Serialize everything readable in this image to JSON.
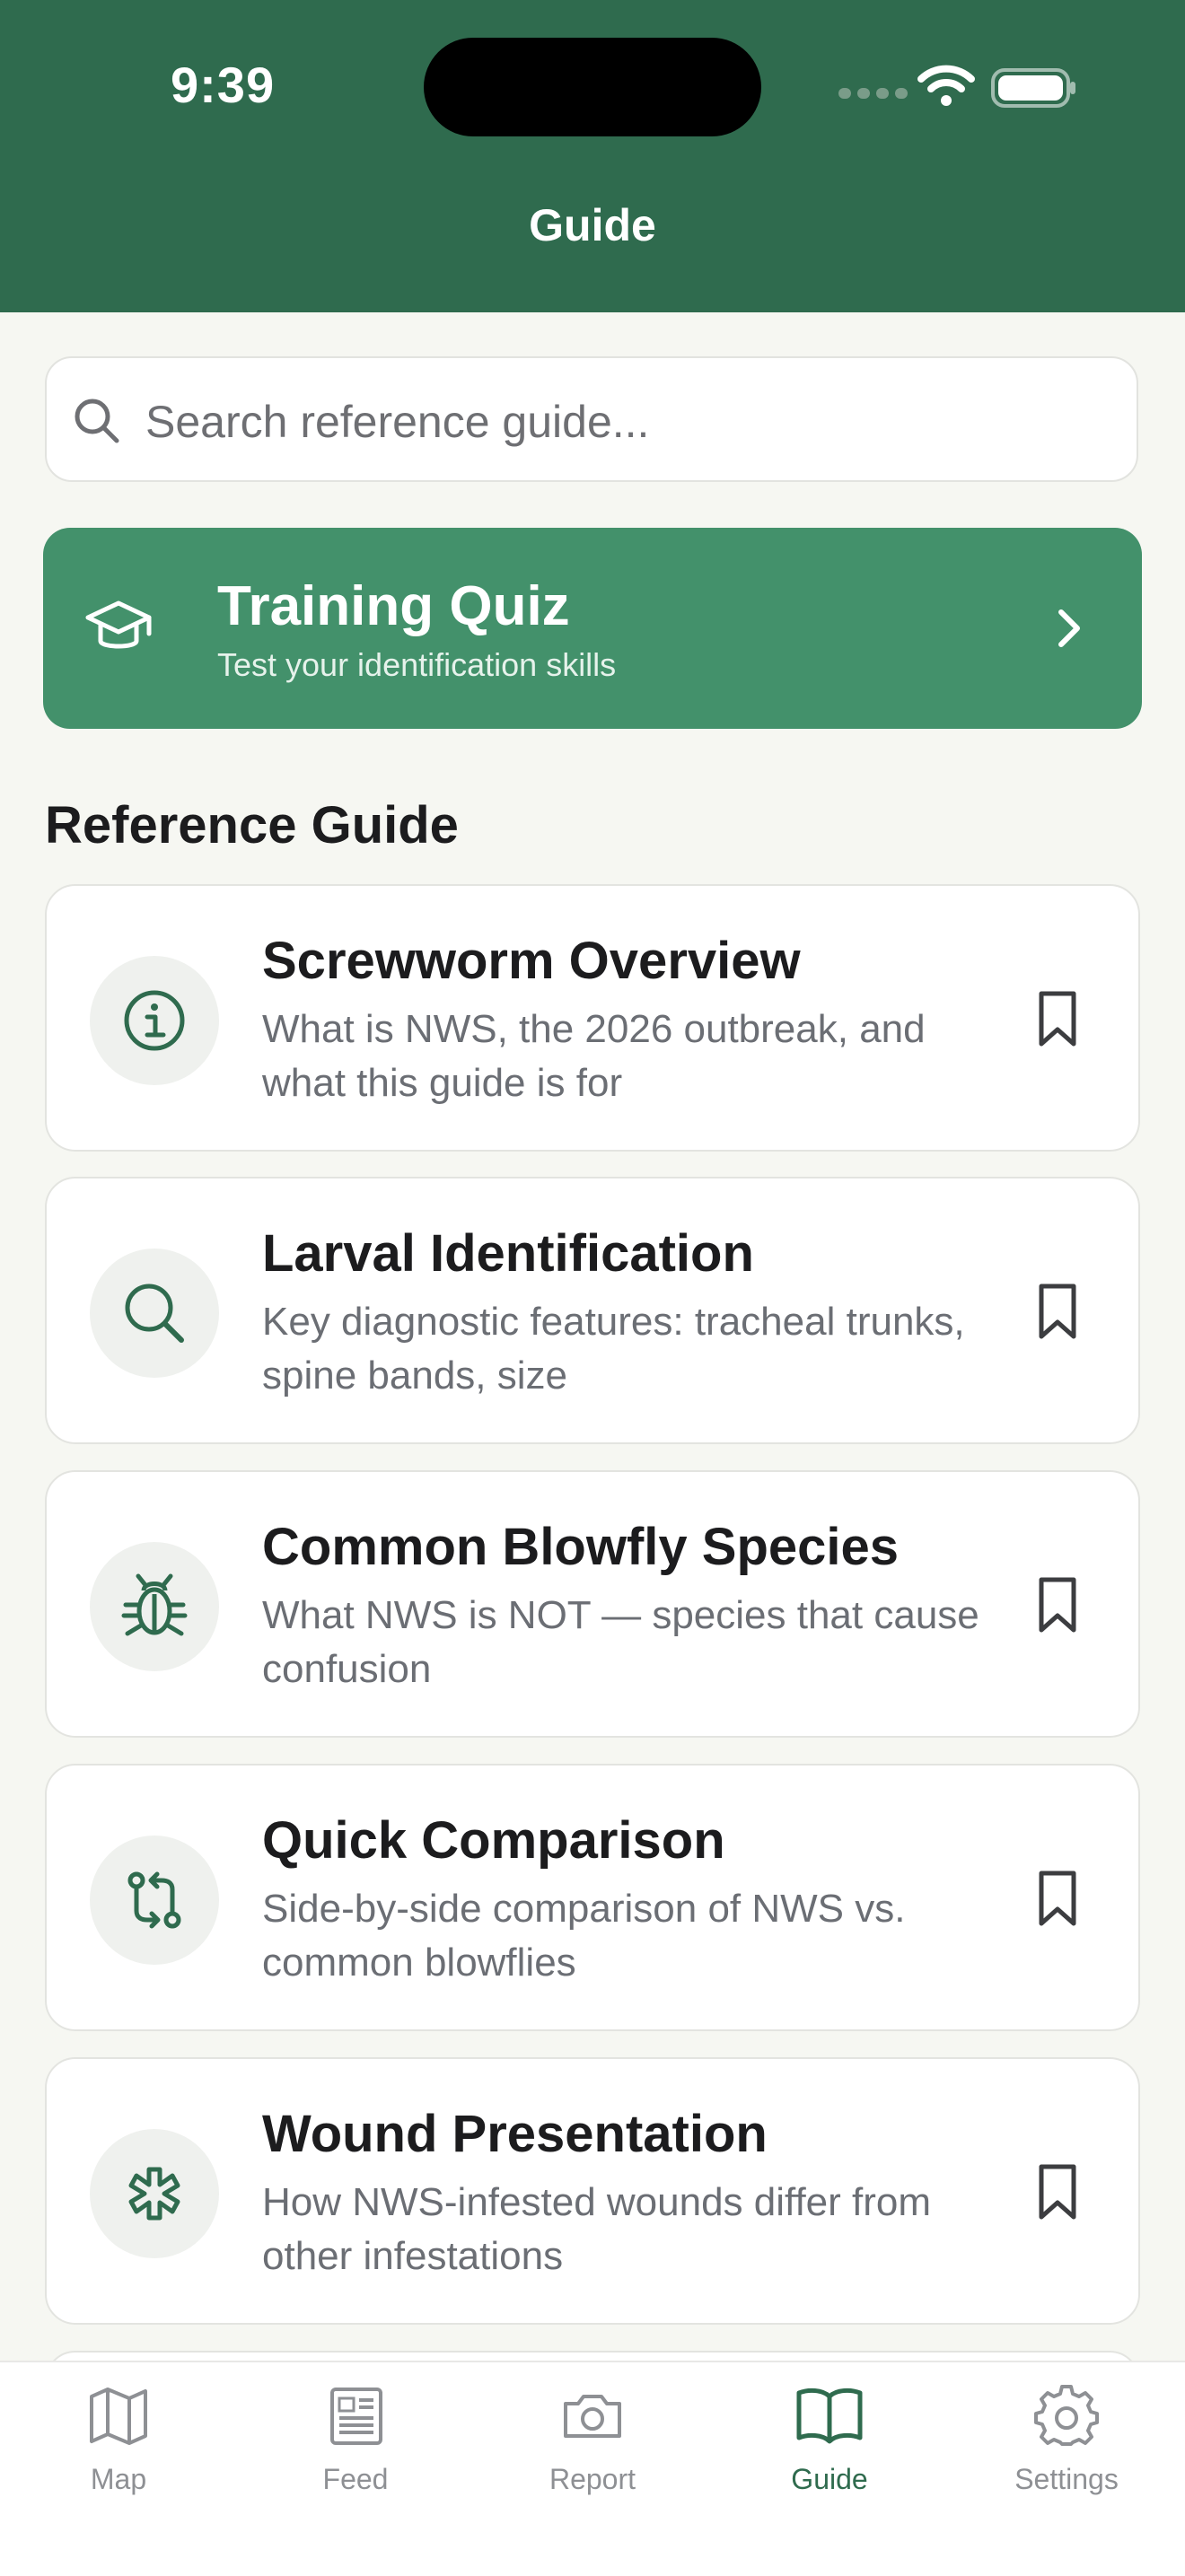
{
  "status_bar": {
    "time": "9:39"
  },
  "header": {
    "title": "Guide"
  },
  "search": {
    "placeholder": "Search reference guide..."
  },
  "quiz": {
    "title": "Training Quiz",
    "subtitle": "Test your identification skills"
  },
  "section": {
    "title": "Reference Guide"
  },
  "cards": [
    {
      "title": "Screwworm Overview",
      "description": "What is NWS, the 2026 outbreak, and what this guide is for",
      "icon": "info-icon"
    },
    {
      "title": "Larval Identification",
      "description": "Key diagnostic features: tracheal trunks, spine bands, size",
      "icon": "search-icon"
    },
    {
      "title": "Common Blowfly Species",
      "description": "What NWS is NOT — species that cause confusion",
      "icon": "bug-icon"
    },
    {
      "title": "Quick Comparison",
      "description": "Side-by-side comparison of NWS vs. common blowflies",
      "icon": "compare-arrows-icon"
    },
    {
      "title": "Wound Presentation",
      "description": "How NWS-infested wounds differ from other infestations",
      "icon": "asterisk-icon"
    }
  ],
  "tabs": [
    {
      "label": "Map",
      "icon": "map-icon",
      "active": false
    },
    {
      "label": "Feed",
      "icon": "newspaper-icon",
      "active": false
    },
    {
      "label": "Report",
      "icon": "camera-icon",
      "active": false
    },
    {
      "label": "Guide",
      "icon": "book-open-icon",
      "active": true
    },
    {
      "label": "Settings",
      "icon": "gear-icon",
      "active": false
    }
  ],
  "colors": {
    "brand": "#2f6b4e",
    "quiz": "#43916b",
    "background": "#f6f7f2"
  }
}
